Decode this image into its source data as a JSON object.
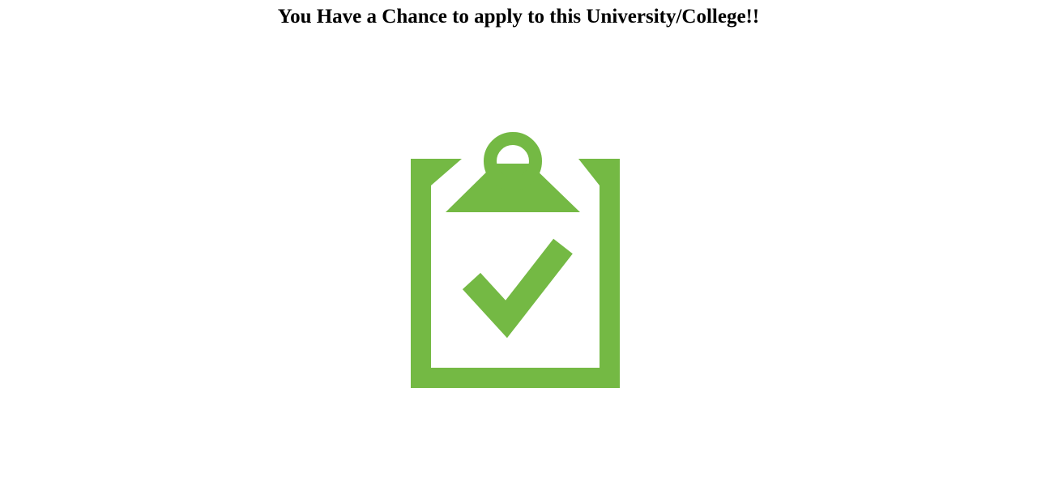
{
  "page": {
    "title": "You Have a Chance to apply to this University/College!!"
  },
  "result_icon": {
    "name": "clipboard-check-icon",
    "color": "#74b944"
  }
}
